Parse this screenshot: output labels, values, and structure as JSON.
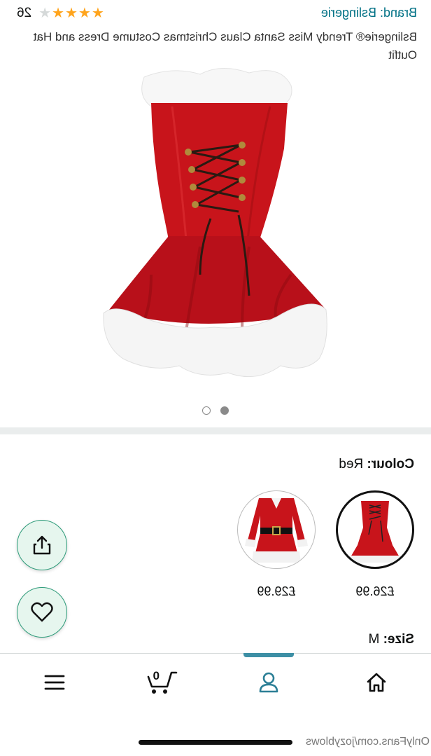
{
  "product": {
    "brand_label": "Brand: Bslingerie",
    "rating_stars": 4,
    "rating_max": 5,
    "review_count": "26",
    "title": "Bslingerie® Trendy Miss Santa Claus Christmas Costume Dress and Hat Outfit"
  },
  "gallery": {
    "image_count": 2,
    "active_index": 0
  },
  "variations": {
    "colour_label": "Colour:",
    "colour_value": "Red",
    "options": [
      {
        "price": "£26.99",
        "selected": true
      },
      {
        "price": "£29.99",
        "selected": false
      }
    ],
    "size_label": "Size:",
    "size_value": "M"
  },
  "bottom_nav": {
    "cart_count": "0",
    "active_item": "account"
  },
  "watermark": "OnlyFans.com/jozyblows",
  "colors": {
    "link": "#007185",
    "star": "#ffa41c",
    "nav_indicator": "#3d8fa5",
    "fab_bg": "#e6f6ee",
    "fab_border": "#2e9c7a",
    "dress_red": "#c8141b"
  }
}
